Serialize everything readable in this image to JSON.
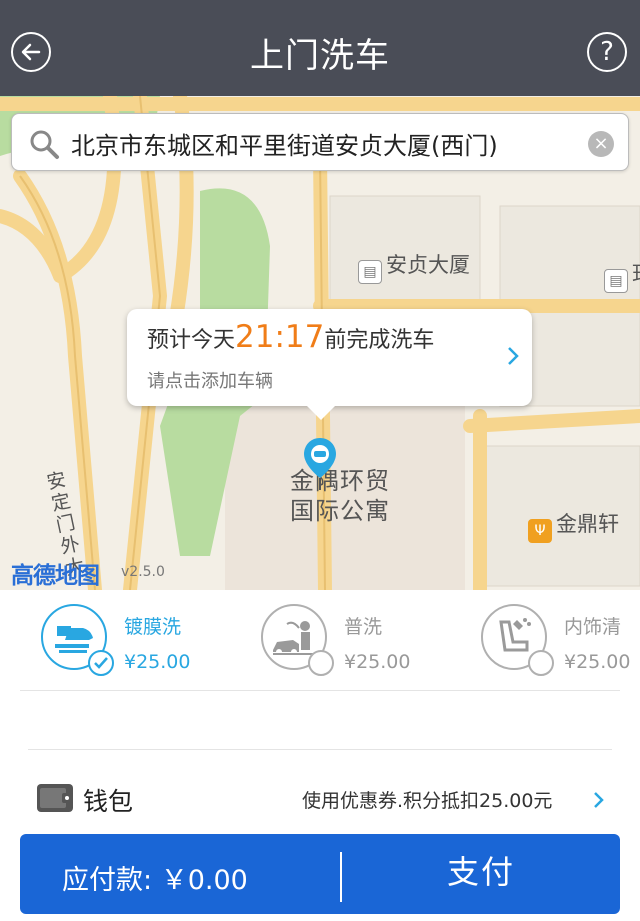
{
  "header": {
    "title": "上门洗车",
    "back_icon": "back-arrow-icon",
    "help_icon": "question-mark-icon",
    "help_glyph": "?"
  },
  "map": {
    "search": {
      "address": "北京市东城区和平里街道安贞大厦(西门)",
      "clear_glyph": "×"
    },
    "poi_anzhen": "安贞大厦",
    "poi_jinding": "金鼎轩",
    "poi_edge": "珏",
    "road_label": "安定门外大",
    "building_name_line1": "金隅环贸",
    "building_name_line2": "国际公寓",
    "bubble": {
      "prefix": "预计今天",
      "time": "21:17",
      "suffix": "前完成洗车",
      "subtext": "请点击添加车辆"
    },
    "logo": "高德地图",
    "version": "v2.5.0"
  },
  "services": [
    {
      "name": "镀膜洗",
      "price": "¥25.00",
      "selected": true,
      "icon": "car-coating-wash-icon"
    },
    {
      "name": "普洗",
      "price": "¥25.00",
      "selected": false,
      "icon": "car-standard-wash-icon"
    },
    {
      "name": "内饰清",
      "price": "¥25.00",
      "selected": false,
      "icon": "car-interior-clean-icon"
    }
  ],
  "wallet": {
    "label": "钱包",
    "hint": "使用优惠券.积分抵扣25.00元"
  },
  "pay": {
    "due_label": "应付款:",
    "due_amount": "￥0.00",
    "button": "支付"
  },
  "colors": {
    "header_bg": "#4a4d57",
    "accent": "#29a7e1",
    "pay_bg": "#1a66d6",
    "time_highlight": "#f07d18",
    "map_road": "#f6d58e",
    "map_green": "#b8dca0"
  }
}
